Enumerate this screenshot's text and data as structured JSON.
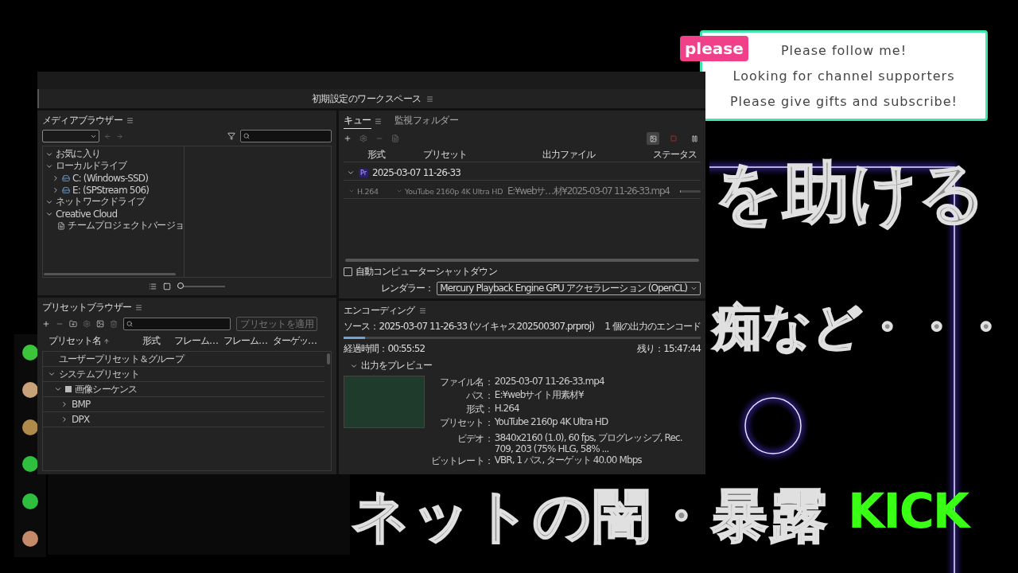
{
  "overlay_card": {
    "badge": "please",
    "lines": [
      "Please follow me!",
      "Looking for channel supporters",
      "Please give gifts and subscribe!"
    ]
  },
  "background_text": [
    "を助ける",
    "痴など・・・",
    "ネットの闇・暴露"
  ],
  "logo": "KICK",
  "app": {
    "workspace": "初期設定のワークスペース",
    "media_browser": {
      "title": "メディアブラウザー",
      "tree": [
        {
          "label": "お気に入り",
          "expanded": true
        },
        {
          "label": "ローカルドライブ",
          "expanded": true,
          "children": [
            {
              "label": "C: (Windows-SSD)",
              "kind": "drive",
              "expanded": false
            },
            {
              "label": "E: (SPStream 506)",
              "kind": "drive",
              "expanded": false
            }
          ]
        },
        {
          "label": "ネットワークドライブ",
          "expanded": true
        },
        {
          "label": "Creative Cloud",
          "expanded": true,
          "children": [
            {
              "label": "チームプロジェクトバージョ",
              "kind": "document"
            }
          ]
        }
      ],
      "zoom_slider": {
        "level": 0.0
      }
    },
    "queue": {
      "tabs": [
        {
          "label": "キュー",
          "selected": true
        },
        {
          "label": "監視フォルダー",
          "selected": false
        }
      ],
      "columns": [
        "形式",
        "プリセット",
        "出力ファイル",
        "ステータス"
      ],
      "groups": [
        {
          "badge": "Pr",
          "name": "2025-03-07 11-26-33",
          "expanded": true,
          "items": [
            {
              "format": "H.264",
              "preset": "YouTube 2160p 4K Ultra HD",
              "output": "E:¥webサ…材¥2025-03-07 11-26-33.mp4",
              "level": 0.05
            }
          ]
        }
      ],
      "auto_shutdown": {
        "label": "自動コンピューターシャットダウン",
        "checked": false
      },
      "renderer": {
        "label": "レンダラー：",
        "value": "Mercury Playback Engine GPU アクセラレーション (OpenCL)"
      }
    },
    "preset_browser": {
      "title": "プリセットブラウザー",
      "apply_button": {
        "label": "プリセットを適用",
        "disabled": true
      },
      "columns": [
        "プリセット名",
        "形式",
        "フレーム…",
        "フレーム…",
        "ターゲッ…"
      ],
      "tree": [
        {
          "label": "ユーザープリセット＆グループ"
        },
        {
          "label": "システムプリセット",
          "expanded": true,
          "children": [
            {
              "label": "画像シーケンス",
              "kind": "category",
              "expanded": true,
              "children": [
                {
                  "label": "BMP",
                  "expanded": false
                },
                {
                  "label": "DPX",
                  "expanded": false
                }
              ]
            }
          ]
        }
      ]
    },
    "encoding": {
      "title": "エンコーディング",
      "source": "ソース：2025-03-07 11-26-33 (ツイキャス202500307.prproj)",
      "outputs": "1 個の出力のエンコード",
      "level": 0.06,
      "elapsed": "経過時間：00:55:52",
      "remaining": "残り：15:47:44",
      "preview": {
        "label": "出力をプレビュー",
        "expanded": true
      },
      "details": [
        {
          "label": "ファイル名：",
          "value": "2025-03-07 11-26-33.mp4"
        },
        {
          "label": "パス：",
          "value": "E:¥webサイト用素材¥"
        },
        {
          "label": "形式：",
          "value": "H.264"
        },
        {
          "label": "プリセット：",
          "value": "YouTube 2160p 4K Ultra HD"
        },
        {
          "label": "ビデオ：",
          "value": "3840x2160 (1.0), 60 fps, プログレッシブ, Rec. 709, 203 (75% HLG, 58% ..."
        },
        {
          "label": "ビットレート：",
          "value": "VBR, 1 パス, ターゲット 40.00 Mbps"
        }
      ]
    }
  }
}
